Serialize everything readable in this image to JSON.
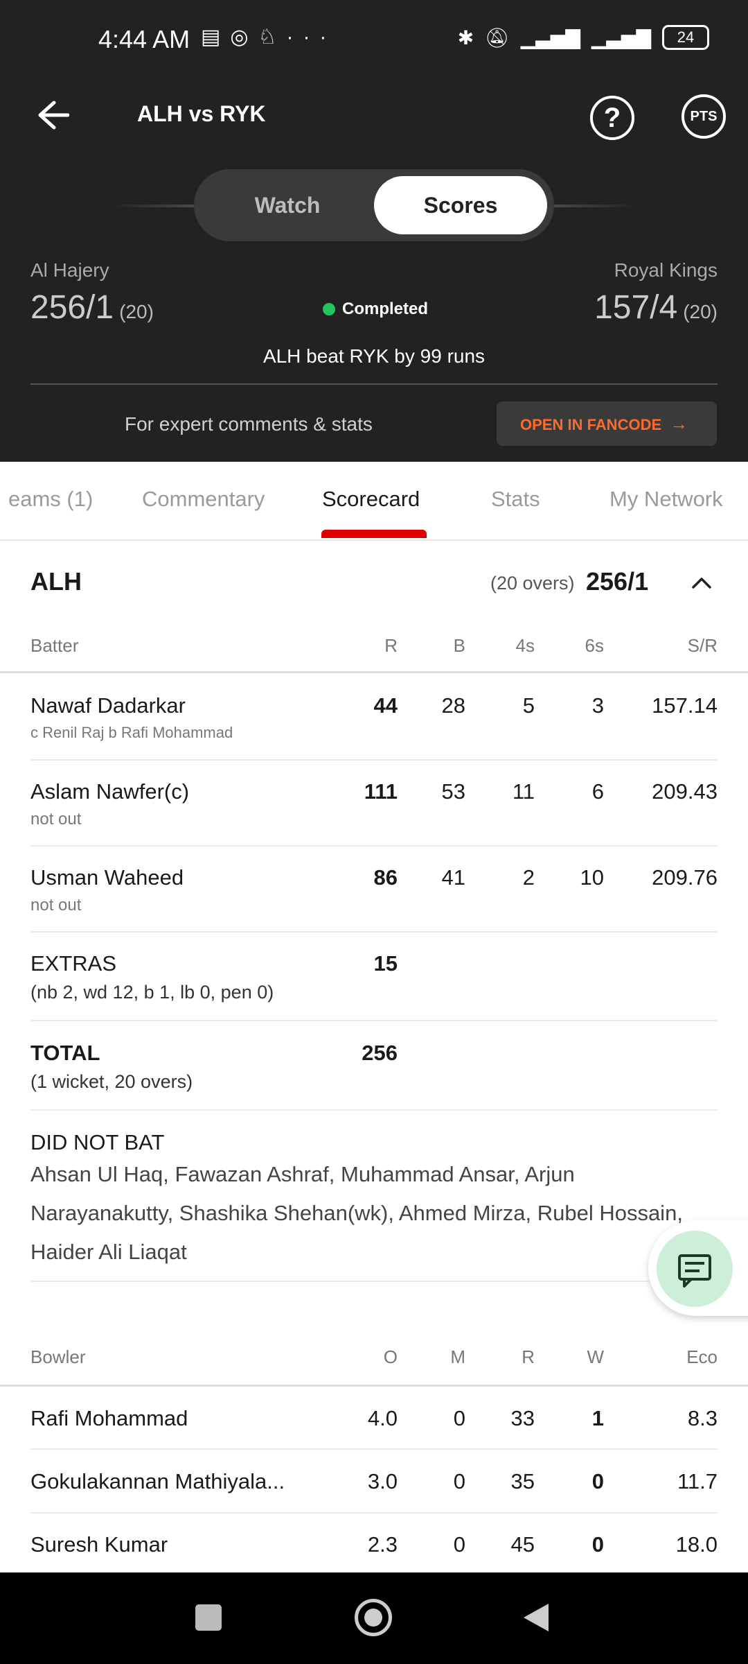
{
  "status_bar": {
    "time": "4:44 AM",
    "more": "···",
    "battery": "24"
  },
  "header": {
    "title": "ALH vs RYK"
  },
  "segment": {
    "watch": "Watch",
    "scores": "Scores"
  },
  "match": {
    "team1_name": "Al Hajery",
    "team1_score": "256/1",
    "team1_overs": "(20)",
    "team2_name": "Royal Kings",
    "team2_score": "157/4",
    "team2_overs": "(20)",
    "status": "Completed",
    "status_color": "#22c55e",
    "result": "ALH beat RYK by 99 runs"
  },
  "promo": {
    "text": "For expert comments & stats",
    "button": "OPEN IN FANCODE",
    "button_color": "#ff6a2b"
  },
  "tabs": [
    "eams (1)",
    "Commentary",
    "Scorecard",
    "Stats",
    "My Network"
  ],
  "active_tab": "Scorecard",
  "innings": {
    "team": "ALH",
    "overs": "(20 overs)",
    "score": "256/1"
  },
  "batting": {
    "headers": {
      "batter": "Batter",
      "r": "R",
      "b": "B",
      "fours": "4s",
      "sixes": "6s",
      "sr": "S/R"
    },
    "rows": [
      {
        "name": "Nawaf Dadarkar",
        "dismissal": "c Renil Raj b Rafi Mohammad",
        "r": "44",
        "b": "28",
        "fours": "5",
        "sixes": "3",
        "sr": "157.14"
      },
      {
        "name": "Aslam Nawfer(c)",
        "dismissal": "not out",
        "r": "111",
        "b": "53",
        "fours": "11",
        "sixes": "6",
        "sr": "209.43"
      },
      {
        "name": "Usman Waheed",
        "dismissal": "not out",
        "r": "86",
        "b": "41",
        "fours": "2",
        "sixes": "10",
        "sr": "209.76"
      }
    ],
    "extras": {
      "label": "EXTRAS",
      "detail": "(nb 2, wd 12, b 1, lb 0, pen 0)",
      "value": "15"
    },
    "total": {
      "label": "TOTAL",
      "detail": "(1 wicket, 20 overs)",
      "value": "256"
    },
    "did_not_bat": {
      "label": "DID NOT BAT",
      "players": "Ahsan Ul Haq, Fawazan Ashraf, Muhammad Ansar, Arjun Narayanakutty, Shashika Shehan(wk), Ahmed Mirza, Rubel Hossain, Haider Ali Liaqat"
    }
  },
  "bowling": {
    "headers": {
      "bowler": "Bowler",
      "o": "O",
      "m": "M",
      "r": "R",
      "w": "W",
      "eco": "Eco"
    },
    "rows": [
      {
        "name": "Rafi Mohammad",
        "o": "4.0",
        "m": "0",
        "r": "33",
        "w": "1",
        "eco": "8.3"
      },
      {
        "name": "Gokulakannan Mathiyala...",
        "o": "3.0",
        "m": "0",
        "r": "35",
        "w": "0",
        "eco": "11.7"
      },
      {
        "name": "Suresh Kumar",
        "o": "2.3",
        "m": "0",
        "r": "45",
        "w": "0",
        "eco": "18.0"
      }
    ]
  }
}
